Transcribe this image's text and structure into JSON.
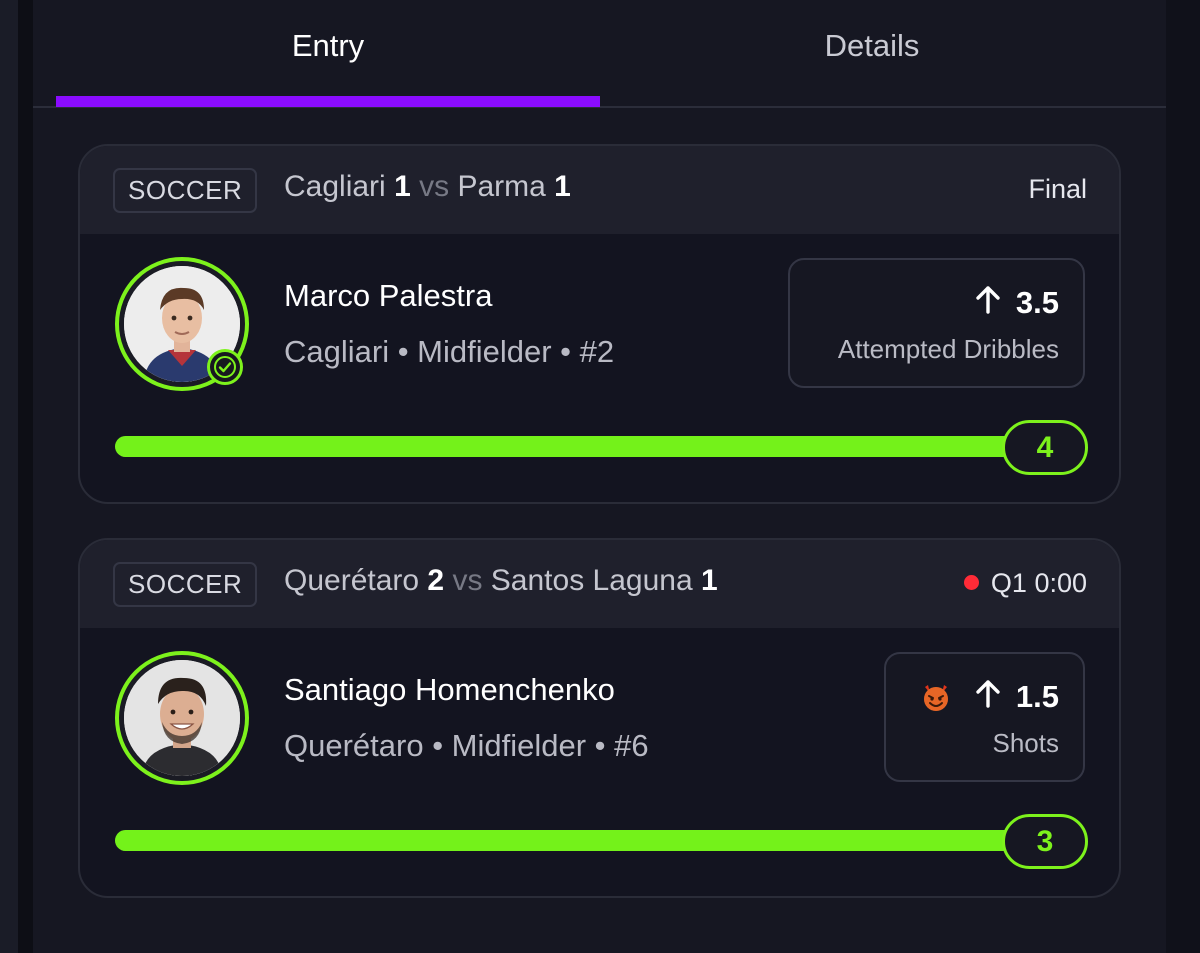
{
  "tabs": [
    {
      "label": "Entry",
      "active": true
    },
    {
      "label": "Details",
      "active": false
    }
  ],
  "colors": {
    "accent_tab": "#8a0cff",
    "progress_green": "#74f21a",
    "live_red": "#ff2b37"
  },
  "cards": [
    {
      "sport": "SOCCER",
      "home_team": "Cagliari",
      "home_score": "1",
      "vs": "vs",
      "away_team": "Parma",
      "away_score": "1",
      "status": "Final",
      "live": false,
      "player": {
        "name": "Marco Palestra",
        "meta": "Cagliari • Midfielder • #2",
        "verified": true
      },
      "pick": {
        "direction_icon": "arrow-up-icon",
        "line": "3.5",
        "stat": "Attempted Dribbles",
        "tag_icon": ""
      },
      "progress": {
        "value": "4",
        "fraction": 1.0
      }
    },
    {
      "sport": "SOCCER",
      "home_team": "Querétaro",
      "home_score": "2",
      "vs": "vs",
      "away_team": "Santos Laguna",
      "away_score": "1",
      "status": "Q1 0:00",
      "live": true,
      "player": {
        "name": "Santiago Homenchenko",
        "meta": "Querétaro • Midfielder • #6",
        "verified": false
      },
      "pick": {
        "direction_icon": "arrow-up-icon",
        "line": "1.5",
        "stat": "Shots",
        "tag_icon": "devil-emoji-icon"
      },
      "progress": {
        "value": "3",
        "fraction": 1.0
      }
    }
  ]
}
